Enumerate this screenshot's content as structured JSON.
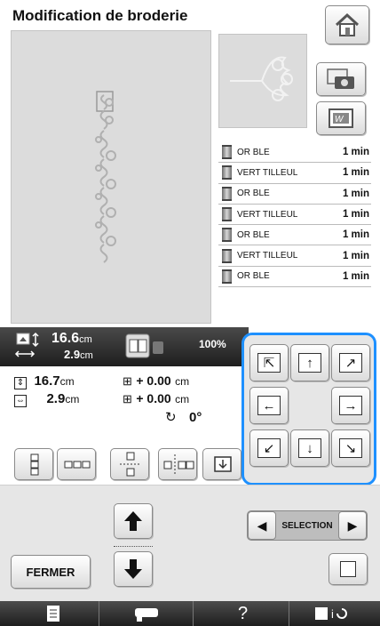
{
  "header": {
    "title": "Modification de broderie",
    "home_icon": "home-icon"
  },
  "preview_buttons": {
    "camera_icon": "camera-scan-icon",
    "frame_icon": "frame-background-icon"
  },
  "threads": [
    {
      "name": "OR BLE",
      "time": "1 min"
    },
    {
      "name": "VERT TILLEUL",
      "time": "1 min"
    },
    {
      "name": "OR BLE",
      "time": "1 min"
    },
    {
      "name": "VERT TILLEUL",
      "time": "1 min"
    },
    {
      "name": "OR BLE",
      "time": "1 min"
    },
    {
      "name": "VERT TILLEUL",
      "time": "1 min"
    },
    {
      "name": "OR BLE",
      "time": "1 min"
    }
  ],
  "size": {
    "width_value": "16.6",
    "height_value": "2.9",
    "unit": "cm",
    "zoom": "100%"
  },
  "info": {
    "height_value": "16.7",
    "width_value": "2.9",
    "unit": "cm",
    "offset_y": "+ 0.00",
    "offset_x": "+ 0.00",
    "rotation": "0°"
  },
  "selection": {
    "label": "SELECTION"
  },
  "buttons": {
    "close_label": "FERMER"
  },
  "bottombar": {
    "help_label": "?"
  },
  "colors": {
    "accent": "#1e90ff",
    "canvas": "#dcdcdc",
    "bar": "#2a2a2a"
  }
}
